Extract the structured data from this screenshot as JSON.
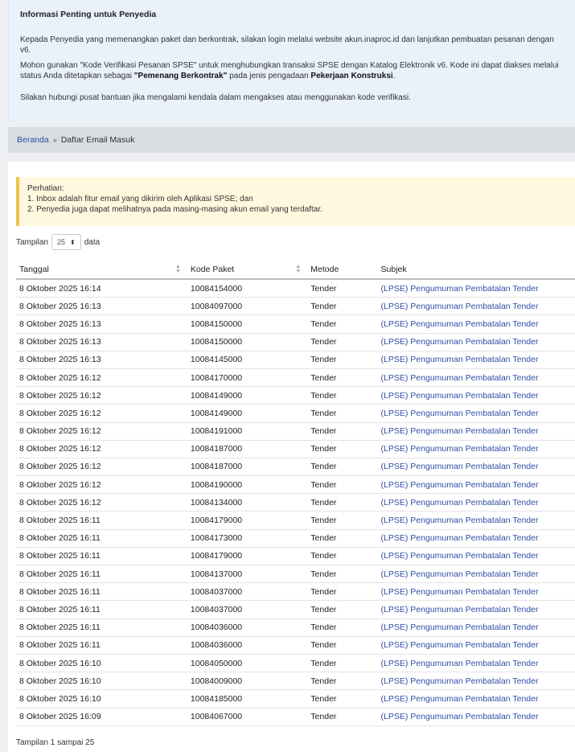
{
  "info": {
    "title": "Informasi Penting untuk Penyedia",
    "p1_line1": "Kepada Penyedia yang memenangkan paket dan berkontrak, silakan login melalui website akun.inaproc.id dan lanjutkan pembuatan pesanan dengan",
    "p1_line2": "v6.",
    "p2_line1": "Mohon gunakan \"Kode Verifikasi Pesanan SPSE\" untuk menghubungkan transaksi SPSE dengan Katalog Elektronik v6. Kode ini dapat diakses melalui",
    "p2_line2_a": "status Anda ditetapkan sebagai ",
    "p2_line2_b": "\"Pemenang Berkontrak\"",
    "p2_line2_c": " pada jenis pengadaan ",
    "p2_line2_d": "Pekerjaan Konstruksi",
    "p2_line2_e": ".",
    "p3": "Silakan hubungi pusat bantuan jika mengalami kendala dalam mengakses atau menggunakan kode verifikasi."
  },
  "breadcrumb": {
    "home": "Beranda",
    "sep": "»",
    "current": "Daftar Email Masuk"
  },
  "notice": {
    "title": "Perhatian:",
    "line1": "1. Inbox adalah fitur email yang dikirim oleh Aplikasi SPSE; dan",
    "line2": "2. Penyedia juga dapat melihatnya pada masing-masing akun email yang terdaftar."
  },
  "length": {
    "prefix": "Tampilan",
    "value": "25",
    "suffix": "data"
  },
  "table": {
    "headers": [
      "Tanggal",
      "Kode Paket",
      "Metode",
      "Subjek"
    ],
    "rows": [
      [
        "8 Oktober 2025 16:14",
        "10084154000",
        "Tender",
        "(LPSE) Pengumuman Pembatalan Tender"
      ],
      [
        "8 Oktober 2025 16:13",
        "10084097000",
        "Tender",
        "(LPSE) Pengumuman Pembatalan Tender"
      ],
      [
        "8 Oktober 2025 16:13",
        "10084150000",
        "Tender",
        "(LPSE) Pengumuman Pembatalan Tender"
      ],
      [
        "8 Oktober 2025 16:13",
        "10084150000",
        "Tender",
        "(LPSE) Pengumuman Pembatalan Tender"
      ],
      [
        "8 Oktober 2025 16:13",
        "10084145000",
        "Tender",
        "(LPSE) Pengumuman Pembatalan Tender"
      ],
      [
        "8 Oktober 2025 16:12",
        "10084170000",
        "Tender",
        "(LPSE) Pengumuman Pembatalan Tender"
      ],
      [
        "8 Oktober 2025 16:12",
        "10084149000",
        "Tender",
        "(LPSE) Pengumuman Pembatalan Tender"
      ],
      [
        "8 Oktober 2025 16:12",
        "10084149000",
        "Tender",
        "(LPSE) Pengumuman Pembatalan Tender"
      ],
      [
        "8 Oktober 2025 16:12",
        "10084191000",
        "Tender",
        "(LPSE) Pengumuman Pembatalan Tender"
      ],
      [
        "8 Oktober 2025 16:12",
        "10084187000",
        "Tender",
        "(LPSE) Pengumuman Pembatalan Tender"
      ],
      [
        "8 Oktober 2025 16:12",
        "10084187000",
        "Tender",
        "(LPSE) Pengumuman Pembatalan Tender"
      ],
      [
        "8 Oktober 2025 16:12",
        "10084190000",
        "Tender",
        "(LPSE) Pengumuman Pembatalan Tender"
      ],
      [
        "8 Oktober 2025 16:12",
        "10084134000",
        "Tender",
        "(LPSE) Pengumuman Pembatalan Tender"
      ],
      [
        "8 Oktober 2025 16:11",
        "10084179000",
        "Tender",
        "(LPSE) Pengumuman Pembatalan Tender"
      ],
      [
        "8 Oktober 2025 16:11",
        "10084173000",
        "Tender",
        "(LPSE) Pengumuman Pembatalan Tender"
      ],
      [
        "8 Oktober 2025 16:11",
        "10084179000",
        "Tender",
        "(LPSE) Pengumuman Pembatalan Tender"
      ],
      [
        "8 Oktober 2025 16:11",
        "10084137000",
        "Tender",
        "(LPSE) Pengumuman Pembatalan Tender"
      ],
      [
        "8 Oktober 2025 16:11",
        "10084037000",
        "Tender",
        "(LPSE) Pengumuman Pembatalan Tender"
      ],
      [
        "8 Oktober 2025 16:11",
        "10084037000",
        "Tender",
        "(LPSE) Pengumuman Pembatalan Tender"
      ],
      [
        "8 Oktober 2025 16:11",
        "10084036000",
        "Tender",
        "(LPSE) Pengumuman Pembatalan Tender"
      ],
      [
        "8 Oktober 2025 16:11",
        "10084036000",
        "Tender",
        "(LPSE) Pengumuman Pembatalan Tender"
      ],
      [
        "8 Oktober 2025 16:10",
        "10084050000",
        "Tender",
        "(LPSE) Pengumuman Pembatalan Tender"
      ],
      [
        "8 Oktober 2025 16:10",
        "10084009000",
        "Tender",
        "(LPSE) Pengumuman Pembatalan Tender"
      ],
      [
        "8 Oktober 2025 16:10",
        "10084185000",
        "Tender",
        "(LPSE) Pengumuman Pembatalan Tender"
      ],
      [
        "8 Oktober 2025 16:09",
        "10084067000",
        "Tender",
        "(LPSE) Pengumuman Pembatalan Tender"
      ]
    ]
  },
  "footer": {
    "info": "Tampilan 1 sampai 25"
  },
  "icons": {
    "length_select": "up-down-caret-icon",
    "sort": "sort-icon"
  },
  "colors": {
    "link": "#2e4fa3",
    "info_bg": "#e9f1fb",
    "notice_bg": "#fff8de",
    "notice_border": "#f0c34a",
    "breadcrumb_bg": "#d9dde2"
  }
}
